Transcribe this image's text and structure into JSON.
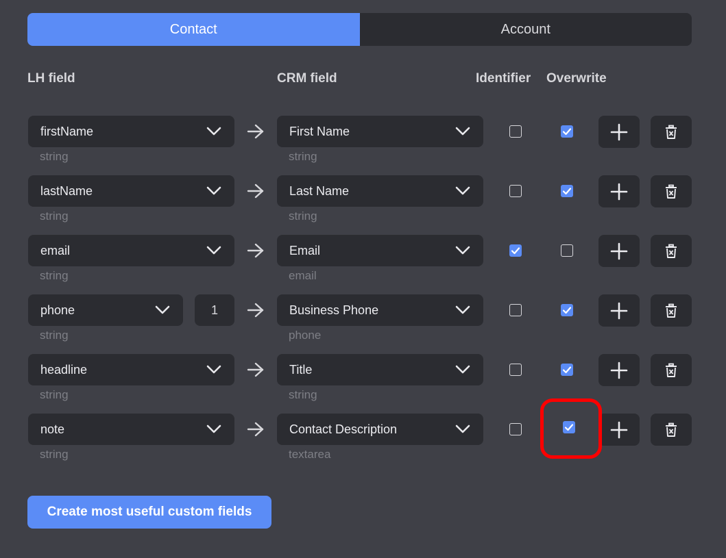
{
  "tabs": [
    {
      "label": "Contact",
      "active": true
    },
    {
      "label": "Account",
      "active": false
    }
  ],
  "columns": {
    "lh_field": "LH field",
    "crm_field": "CRM field",
    "identifier": "Identifier",
    "overwrite": "Overwrite"
  },
  "rows": [
    {
      "lh": "firstName",
      "lh_type": "string",
      "crm": "First Name",
      "crm_type": "string",
      "identifier": false,
      "overwrite": true
    },
    {
      "lh": "lastName",
      "lh_type": "string",
      "crm": "Last Name",
      "crm_type": "string",
      "identifier": false,
      "overwrite": true
    },
    {
      "lh": "email",
      "lh_type": "string",
      "crm": "Email",
      "crm_type": "email",
      "identifier": true,
      "overwrite": false
    },
    {
      "lh": "phone",
      "lh_type": "string",
      "index": "1",
      "crm": "Business Phone",
      "crm_type": "phone",
      "identifier": false,
      "overwrite": true
    },
    {
      "lh": "headline",
      "lh_type": "string",
      "crm": "Title",
      "crm_type": "string",
      "identifier": false,
      "overwrite": true
    },
    {
      "lh": "note",
      "lh_type": "string",
      "crm": "Contact Description",
      "crm_type": "textarea",
      "identifier": false,
      "overwrite": true
    }
  ],
  "icons": {
    "chevron": "chevron-down-icon",
    "arrow": "arrow-right-icon",
    "add": "plus-icon",
    "delete": "trash-icon",
    "check": "checkmark-icon"
  },
  "colors": {
    "accent": "#5b8cf6",
    "background": "#3f4047",
    "control": "#2b2c31",
    "highlight": "#ff0000"
  },
  "create_button": "Create most useful custom fields"
}
